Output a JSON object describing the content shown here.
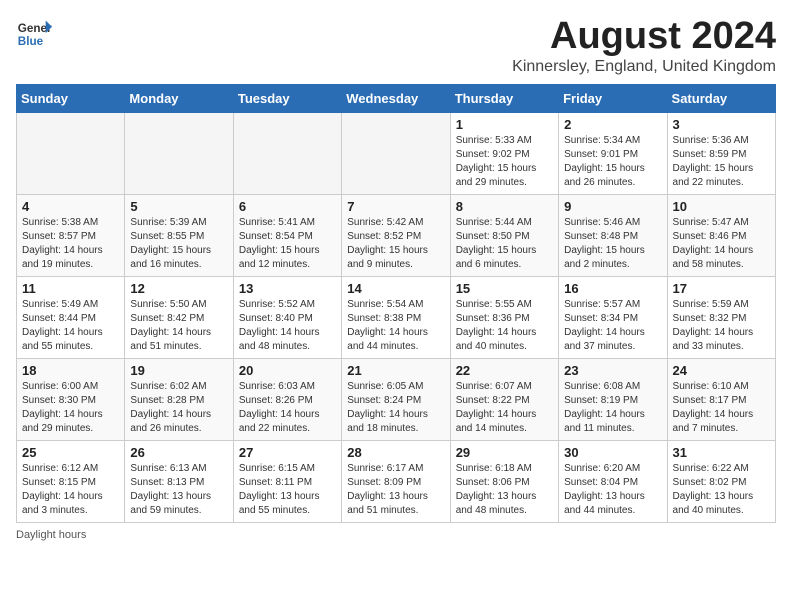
{
  "header": {
    "logo_general": "General",
    "logo_blue": "Blue",
    "title": "August 2024",
    "location": "Kinnersley, England, United Kingdom"
  },
  "days_of_week": [
    "Sunday",
    "Monday",
    "Tuesday",
    "Wednesday",
    "Thursday",
    "Friday",
    "Saturday"
  ],
  "footer": {
    "note": "Daylight hours"
  },
  "weeks": [
    [
      {
        "day": "",
        "empty": true
      },
      {
        "day": "",
        "empty": true
      },
      {
        "day": "",
        "empty": true
      },
      {
        "day": "",
        "empty": true
      },
      {
        "day": "1",
        "sunrise": "5:33 AM",
        "sunset": "9:02 PM",
        "daylight": "15 hours and 29 minutes."
      },
      {
        "day": "2",
        "sunrise": "5:34 AM",
        "sunset": "9:01 PM",
        "daylight": "15 hours and 26 minutes."
      },
      {
        "day": "3",
        "sunrise": "5:36 AM",
        "sunset": "8:59 PM",
        "daylight": "15 hours and 22 minutes."
      }
    ],
    [
      {
        "day": "4",
        "sunrise": "5:38 AM",
        "sunset": "8:57 PM",
        "daylight": "14 hours and 19 minutes."
      },
      {
        "day": "5",
        "sunrise": "5:39 AM",
        "sunset": "8:55 PM",
        "daylight": "15 hours and 16 minutes."
      },
      {
        "day": "6",
        "sunrise": "5:41 AM",
        "sunset": "8:54 PM",
        "daylight": "15 hours and 12 minutes."
      },
      {
        "day": "7",
        "sunrise": "5:42 AM",
        "sunset": "8:52 PM",
        "daylight": "15 hours and 9 minutes."
      },
      {
        "day": "8",
        "sunrise": "5:44 AM",
        "sunset": "8:50 PM",
        "daylight": "15 hours and 6 minutes."
      },
      {
        "day": "9",
        "sunrise": "5:46 AM",
        "sunset": "8:48 PM",
        "daylight": "15 hours and 2 minutes."
      },
      {
        "day": "10",
        "sunrise": "5:47 AM",
        "sunset": "8:46 PM",
        "daylight": "14 hours and 58 minutes."
      }
    ],
    [
      {
        "day": "11",
        "sunrise": "5:49 AM",
        "sunset": "8:44 PM",
        "daylight": "14 hours and 55 minutes."
      },
      {
        "day": "12",
        "sunrise": "5:50 AM",
        "sunset": "8:42 PM",
        "daylight": "14 hours and 51 minutes."
      },
      {
        "day": "13",
        "sunrise": "5:52 AM",
        "sunset": "8:40 PM",
        "daylight": "14 hours and 48 minutes."
      },
      {
        "day": "14",
        "sunrise": "5:54 AM",
        "sunset": "8:38 PM",
        "daylight": "14 hours and 44 minutes."
      },
      {
        "day": "15",
        "sunrise": "5:55 AM",
        "sunset": "8:36 PM",
        "daylight": "14 hours and 40 minutes."
      },
      {
        "day": "16",
        "sunrise": "5:57 AM",
        "sunset": "8:34 PM",
        "daylight": "14 hours and 37 minutes."
      },
      {
        "day": "17",
        "sunrise": "5:59 AM",
        "sunset": "8:32 PM",
        "daylight": "14 hours and 33 minutes."
      }
    ],
    [
      {
        "day": "18",
        "sunrise": "6:00 AM",
        "sunset": "8:30 PM",
        "daylight": "14 hours and 29 minutes."
      },
      {
        "day": "19",
        "sunrise": "6:02 AM",
        "sunset": "8:28 PM",
        "daylight": "14 hours and 26 minutes."
      },
      {
        "day": "20",
        "sunrise": "6:03 AM",
        "sunset": "8:26 PM",
        "daylight": "14 hours and 22 minutes."
      },
      {
        "day": "21",
        "sunrise": "6:05 AM",
        "sunset": "8:24 PM",
        "daylight": "14 hours and 18 minutes."
      },
      {
        "day": "22",
        "sunrise": "6:07 AM",
        "sunset": "8:22 PM",
        "daylight": "14 hours and 14 minutes."
      },
      {
        "day": "23",
        "sunrise": "6:08 AM",
        "sunset": "8:19 PM",
        "daylight": "14 hours and 11 minutes."
      },
      {
        "day": "24",
        "sunrise": "6:10 AM",
        "sunset": "8:17 PM",
        "daylight": "14 hours and 7 minutes."
      }
    ],
    [
      {
        "day": "25",
        "sunrise": "6:12 AM",
        "sunset": "8:15 PM",
        "daylight": "14 hours and 3 minutes."
      },
      {
        "day": "26",
        "sunrise": "6:13 AM",
        "sunset": "8:13 PM",
        "daylight": "13 hours and 59 minutes."
      },
      {
        "day": "27",
        "sunrise": "6:15 AM",
        "sunset": "8:11 PM",
        "daylight": "13 hours and 55 minutes."
      },
      {
        "day": "28",
        "sunrise": "6:17 AM",
        "sunset": "8:09 PM",
        "daylight": "13 hours and 51 minutes."
      },
      {
        "day": "29",
        "sunrise": "6:18 AM",
        "sunset": "8:06 PM",
        "daylight": "13 hours and 48 minutes."
      },
      {
        "day": "30",
        "sunrise": "6:20 AM",
        "sunset": "8:04 PM",
        "daylight": "13 hours and 44 minutes."
      },
      {
        "day": "31",
        "sunrise": "6:22 AM",
        "sunset": "8:02 PM",
        "daylight": "13 hours and 40 minutes."
      }
    ]
  ]
}
